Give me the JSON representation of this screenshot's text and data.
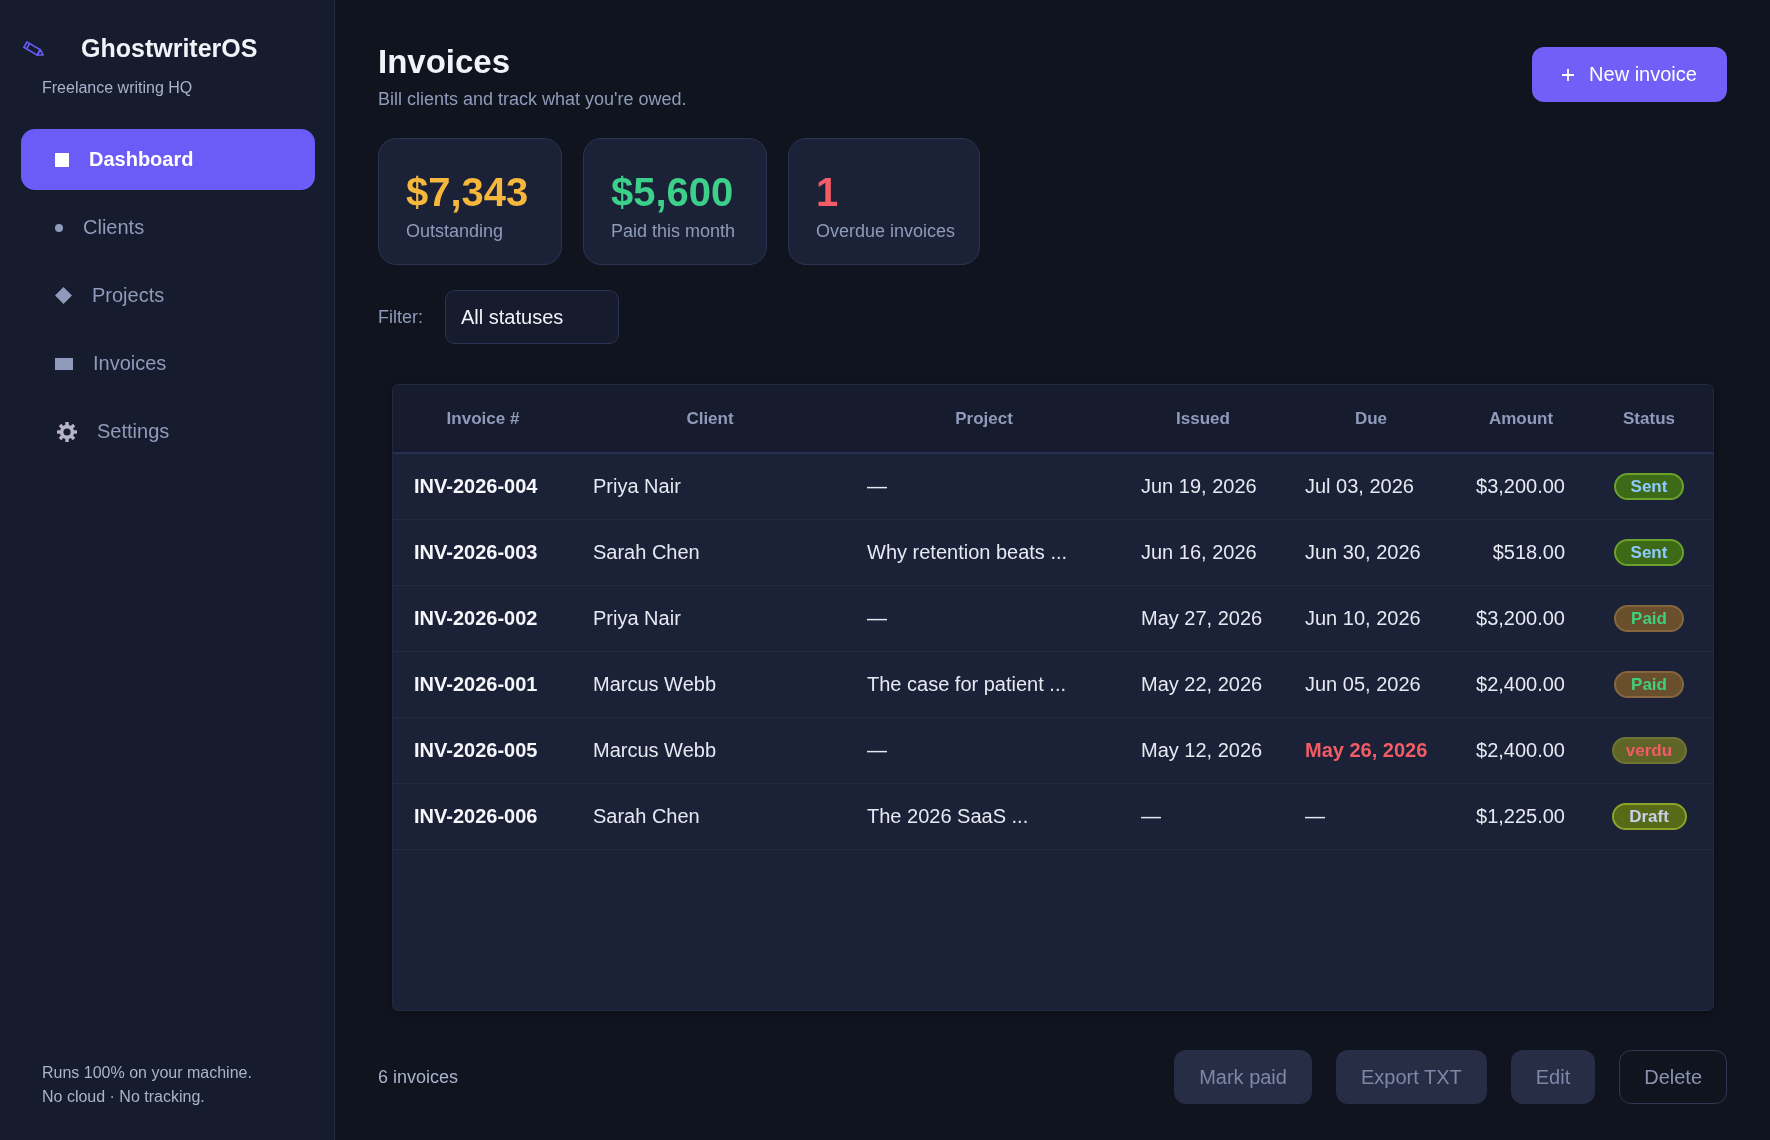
{
  "sidebar": {
    "brand": "GhostwriterOS",
    "tagline": "Freelance writing HQ",
    "nav": [
      {
        "label": "Dashboard",
        "selected": true
      },
      {
        "label": "Clients",
        "selected": false
      },
      {
        "label": "Projects",
        "selected": false
      },
      {
        "label": "Invoices",
        "selected": false
      },
      {
        "label": "Settings",
        "selected": false
      }
    ],
    "footer": [
      "Runs 100% on your machine.",
      "No cloud · No tracking."
    ]
  },
  "header": {
    "title": "Invoices",
    "subtitle": "Bill clients and track what you're owed.",
    "new_button": "New invoice"
  },
  "stats": [
    {
      "value": "$7,343",
      "label": "Outstanding",
      "color": "#f5b83d"
    },
    {
      "value": "$5,600",
      "label": "Paid this month",
      "color": "#3dd08a"
    },
    {
      "value": "1",
      "label": "Overdue invoices",
      "color": "#f25c66"
    }
  ],
  "filter": {
    "label": "Filter:",
    "value": "All statuses"
  },
  "table": {
    "columns": [
      "Invoice #",
      "Client",
      "Project",
      "Issued",
      "Due",
      "Amount",
      "Status"
    ],
    "rows": [
      {
        "invoice": "INV-2026-004",
        "client": "Priya Nair",
        "project": "—",
        "issued": "Jun 19, 2026",
        "due": "Jul 03, 2026",
        "amount": "$3,200.00",
        "status": {
          "label": "Sent",
          "kind": "sent"
        },
        "overdue": false
      },
      {
        "invoice": "INV-2026-003",
        "client": "Sarah Chen",
        "project": "Why retention beats ...",
        "issued": "Jun 16, 2026",
        "due": "Jun 30, 2026",
        "amount": "$518.00",
        "status": {
          "label": "Sent",
          "kind": "sent"
        },
        "overdue": false
      },
      {
        "invoice": "INV-2026-002",
        "client": "Priya Nair",
        "project": "—",
        "issued": "May 27, 2026",
        "due": "Jun 10, 2026",
        "amount": "$3,200.00",
        "status": {
          "label": "Paid",
          "kind": "paid"
        },
        "overdue": false
      },
      {
        "invoice": "INV-2026-001",
        "client": "Marcus Webb",
        "project": "The case for patient ...",
        "issued": "May 22, 2026",
        "due": "Jun 05, 2026",
        "amount": "$2,400.00",
        "status": {
          "label": "Paid",
          "kind": "paid"
        },
        "overdue": false
      },
      {
        "invoice": "INV-2026-005",
        "client": "Marcus Webb",
        "project": "—",
        "issued": "May 12, 2026",
        "due": "May 26, 2026",
        "amount": "$2,400.00",
        "status": {
          "label": "verdu",
          "kind": "overdue"
        },
        "overdue": true
      },
      {
        "invoice": "INV-2026-006",
        "client": "Sarah Chen",
        "project": "The 2026 SaaS ...",
        "issued": "—",
        "due": "—",
        "amount": "$1,225.00",
        "status": {
          "label": "Draft",
          "kind": "draft"
        },
        "overdue": false
      }
    ]
  },
  "footer": {
    "count": "6 invoices",
    "buttons": [
      {
        "label": "Mark paid",
        "kind": "filled",
        "disabled": true
      },
      {
        "label": "Export TXT",
        "kind": "filled",
        "disabled": true
      },
      {
        "label": "Edit",
        "kind": "filled",
        "disabled": true
      },
      {
        "label": "Delete",
        "kind": "outline",
        "disabled": true
      }
    ]
  }
}
